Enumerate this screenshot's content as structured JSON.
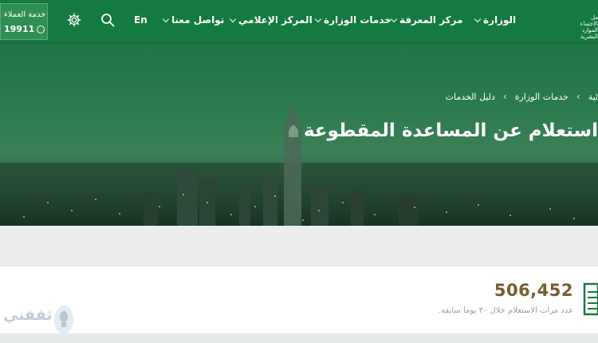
{
  "header": {
    "customer_service": {
      "title": "خدمة العملاء",
      "phone": "19911"
    },
    "settings_icon": "gear-icon",
    "search_icon": "search-icon",
    "language": "En",
    "nav": [
      {
        "label": "الوزارة",
        "has_dropdown": true
      },
      {
        "label": "مركز المعرفة",
        "has_dropdown": true
      },
      {
        "label": "خدمات الوزارة",
        "has_dropdown": true
      },
      {
        "label": "المركز الإعلامي",
        "has_dropdown": true
      },
      {
        "label": "تواصل معنا",
        "has_dropdown": true
      }
    ],
    "logo_text": [
      "مل",
      "الاجتماعية",
      "الموارد البشرية"
    ]
  },
  "hero": {
    "breadcrumb": [
      "ئية",
      "خدمات الوزارة",
      "دليل الخدمات"
    ],
    "title": "استعلام عن المساعدة المقطوعة"
  },
  "stat": {
    "value": "506,452",
    "description": "عدد مرات الاستعلام خلال ٣٠ يوما سابقة."
  },
  "watermark": "ثقفني",
  "colors": {
    "primary": "#157a40",
    "stat_number": "#7a5c2e"
  }
}
